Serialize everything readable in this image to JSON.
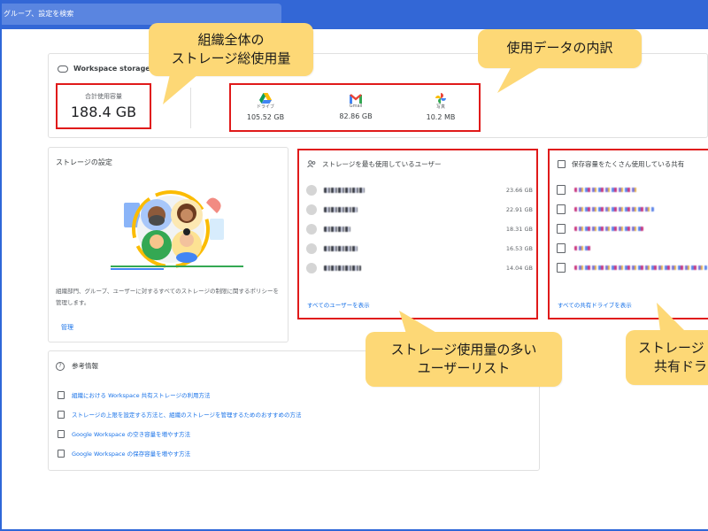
{
  "search": {
    "placeholder_text": "グループ、設定を検索"
  },
  "workspace": {
    "title": "Workspace storage",
    "total_label": "合計使用容量",
    "total_value": "188.4 GB",
    "breakdown": [
      {
        "icon": "google-drive-icon",
        "label": "ドライブ",
        "value": "105.52 GB"
      },
      {
        "icon": "gmail-icon",
        "label": "Gmail",
        "value": "82.86 GB"
      },
      {
        "icon": "google-photos-icon",
        "label": "写真",
        "value": "10.2 MB"
      }
    ]
  },
  "settings": {
    "title": "ストレージの設定",
    "description": "組織部門、グループ、ユーザーに対するすべてのストレージの制限に関するポリシーを管理します。",
    "manage_label": "管理"
  },
  "top_users": {
    "title": "ストレージを最も使用しているユーザー",
    "rows": [
      {
        "value": "23.66 GB"
      },
      {
        "value": "22.91 GB"
      },
      {
        "value": "18.31 GB"
      },
      {
        "value": "16.53 GB"
      },
      {
        "value": "14.04 GB"
      }
    ],
    "link": "すべてのユーザーを表示"
  },
  "top_drives": {
    "title": "保存容量をたくさん使用している共有",
    "link": "すべての共有ドライブを表示"
  },
  "references": {
    "title": "参考情報",
    "links": [
      "組織における Workspace 共有ストレージの利用方法",
      "ストレージの上限を設定する方法と、組織のストレージを管理するためのおすすめの方法",
      "Google Workspace の空き容量を増やす方法",
      "Google Workspace の保存容量を増やす方法"
    ]
  },
  "callouts": {
    "total": [
      "組織全体の",
      "ストレージ総使用量"
    ],
    "breakdown": [
      "使用データの内訳"
    ],
    "users": [
      "ストレージ使用量の多い",
      "ユーザーリスト"
    ],
    "drives": [
      "ストレージ",
      "共有ドラ"
    ]
  },
  "colors": {
    "accent": "#1a73e8",
    "highlight_border": "#e01a1a",
    "callout_fill": "#fdd876",
    "topbar": "#3367d6"
  }
}
